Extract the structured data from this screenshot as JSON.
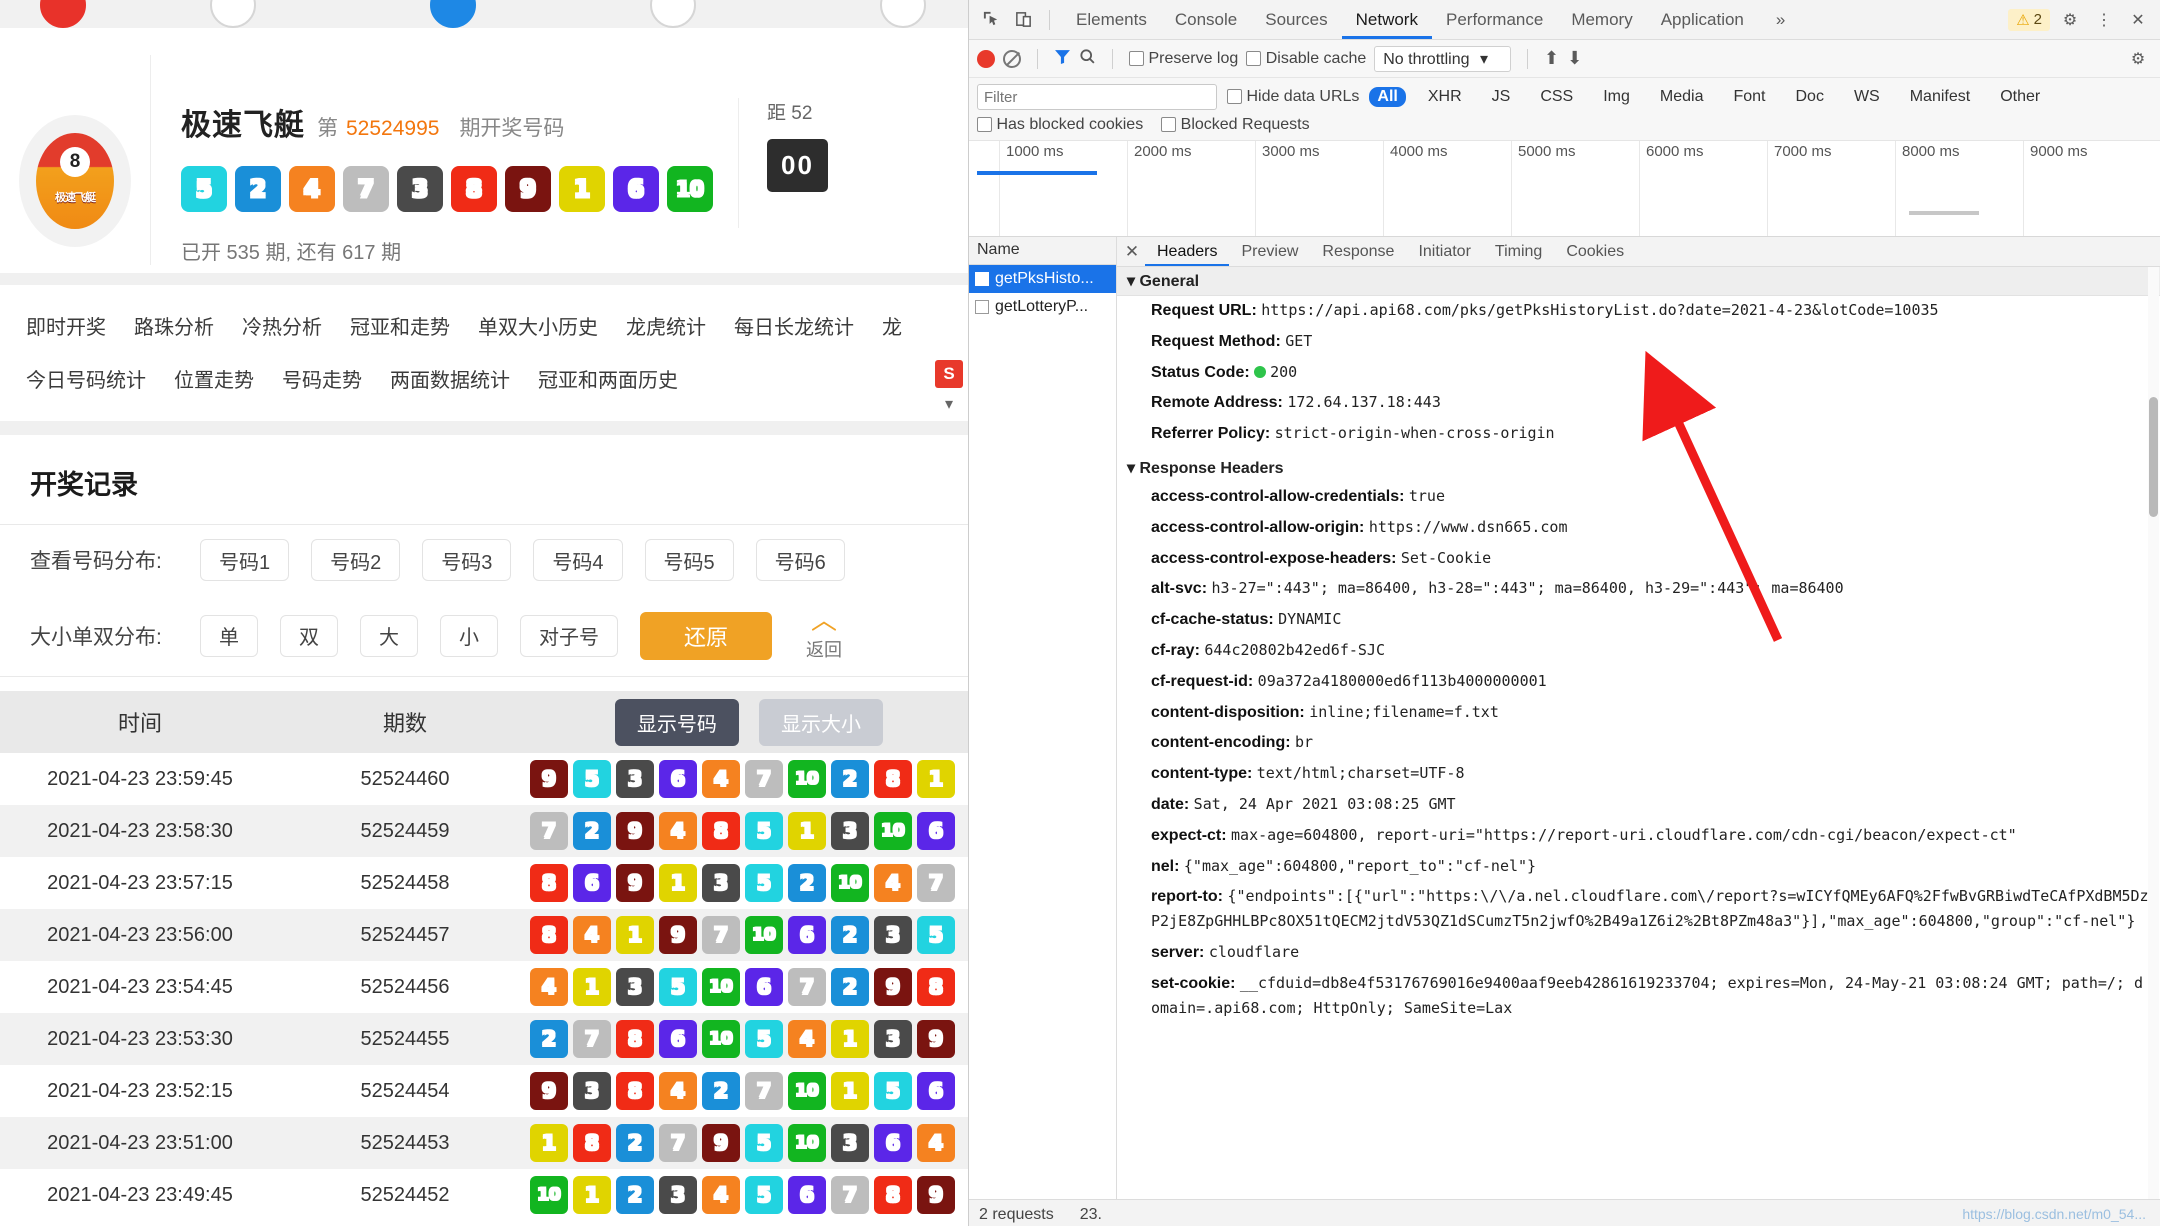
{
  "webpage": {
    "lottery": {
      "name": "极速飞艇",
      "issue_prefix": "第",
      "issue_number": "52524995",
      "issue_suffix": "期开奖号码",
      "logo_badge": "8",
      "logo_text": "极速飞艇",
      "balls": [
        {
          "n": "5",
          "color": "#22d3e0"
        },
        {
          "n": "2",
          "color": "#1a8fd8"
        },
        {
          "n": "4",
          "color": "#f58220"
        },
        {
          "n": "7",
          "color": "#bdbdbd"
        },
        {
          "n": "3",
          "color": "#4a4a4a"
        },
        {
          "n": "8",
          "color": "#f02b16"
        },
        {
          "n": "9",
          "color": "#7a1410"
        },
        {
          "n": "1",
          "color": "#e0d400"
        },
        {
          "n": "6",
          "color": "#5b26e8"
        },
        {
          "n": "10",
          "color": "#12b520"
        }
      ],
      "meta": "已开 535 期, 还有 617 期",
      "countdown_label": "距 52",
      "countdown_value": "00"
    },
    "nav_row1": [
      "即时开奖",
      "路珠分析",
      "冷热分析",
      "冠亚和走势",
      "单双大小历史",
      "龙虎统计",
      "每日长龙统计",
      "龙"
    ],
    "nav_row2": [
      "今日号码统计",
      "位置走势",
      "号码走势",
      "两面数据统计",
      "冠亚和两面历史"
    ],
    "record": {
      "title": "开奖记录",
      "filter1_label": "查看号码分布:",
      "filter1_buttons": [
        "号码1",
        "号码2",
        "号码3",
        "号码4",
        "号码5",
        "号码6"
      ],
      "filter2_label": "大小单双分布:",
      "filter2_buttons": [
        "单",
        "双",
        "大",
        "小",
        "对子号"
      ],
      "restore_label": "还原",
      "back_arrow": "︿",
      "back_label": "返回",
      "table_headers": [
        "时间",
        "期数"
      ],
      "toggle_numbers": "显示号码",
      "toggle_size": "显示大小",
      "rows": [
        {
          "time": "2021-04-23 23:59:45",
          "issue": "52524460",
          "balls": [
            "9",
            "5",
            "3",
            "6",
            "4",
            "7",
            "10",
            "2",
            "8",
            "1"
          ]
        },
        {
          "time": "2021-04-23 23:58:30",
          "issue": "52524459",
          "balls": [
            "7",
            "2",
            "9",
            "4",
            "8",
            "5",
            "1",
            "3",
            "10",
            "6"
          ]
        },
        {
          "time": "2021-04-23 23:57:15",
          "issue": "52524458",
          "balls": [
            "8",
            "6",
            "9",
            "1",
            "3",
            "5",
            "2",
            "10",
            "4",
            "7"
          ]
        },
        {
          "time": "2021-04-23 23:56:00",
          "issue": "52524457",
          "balls": [
            "8",
            "4",
            "1",
            "9",
            "7",
            "10",
            "6",
            "2",
            "3",
            "5"
          ]
        },
        {
          "time": "2021-04-23 23:54:45",
          "issue": "52524456",
          "balls": [
            "4",
            "1",
            "3",
            "5",
            "10",
            "6",
            "7",
            "2",
            "9",
            "8"
          ]
        },
        {
          "time": "2021-04-23 23:53:30",
          "issue": "52524455",
          "balls": [
            "2",
            "7",
            "8",
            "6",
            "10",
            "5",
            "4",
            "1",
            "3",
            "9"
          ]
        },
        {
          "time": "2021-04-23 23:52:15",
          "issue": "52524454",
          "balls": [
            "9",
            "3",
            "8",
            "4",
            "2",
            "7",
            "10",
            "1",
            "5",
            "6"
          ]
        },
        {
          "time": "2021-04-23 23:51:00",
          "issue": "52524453",
          "balls": [
            "1",
            "8",
            "2",
            "7",
            "9",
            "5",
            "10",
            "3",
            "6",
            "4"
          ]
        },
        {
          "time": "2021-04-23 23:49:45",
          "issue": "52524452",
          "balls": [
            "10",
            "1",
            "2",
            "3",
            "4",
            "5",
            "6",
            "7",
            "8",
            "9"
          ]
        }
      ]
    },
    "ball_colors": {
      "1": "#e0d400",
      "2": "#1a8fd8",
      "3": "#4a4a4a",
      "4": "#f58220",
      "5": "#22d3e0",
      "6": "#5b26e8",
      "7": "#bdbdbd",
      "8": "#f02b16",
      "9": "#7a1410",
      "10": "#12b520"
    }
  },
  "devtools": {
    "tabs": [
      "Elements",
      "Console",
      "Sources",
      "Network",
      "Performance",
      "Memory",
      "Application"
    ],
    "active_tab": "Network",
    "more_tabs": "»",
    "warning_count": "2",
    "netbar": {
      "preserve_log": "Preserve log",
      "disable_cache": "Disable cache",
      "throttling": "No throttling"
    },
    "filterbar": {
      "filter_placeholder": "Filter",
      "hide_data_urls": "Hide data URLs",
      "types": [
        "All",
        "XHR",
        "JS",
        "CSS",
        "Img",
        "Media",
        "Font",
        "Doc",
        "WS",
        "Manifest",
        "Other"
      ],
      "active_type": "All",
      "has_blocked_cookies": "Has blocked cookies",
      "blocked_requests": "Blocked Requests"
    },
    "timeline_ticks": [
      "1000 ms",
      "2000 ms",
      "3000 ms",
      "4000 ms",
      "5000 ms",
      "6000 ms",
      "7000 ms",
      "8000 ms",
      "9000 ms"
    ],
    "requests_header": "Name",
    "requests": [
      "getPksHisto...",
      "getLotteryP..."
    ],
    "selected_request": "getPksHisto...",
    "detail_tabs": [
      "Headers",
      "Preview",
      "Response",
      "Initiator",
      "Timing",
      "Cookies"
    ],
    "active_detail_tab": "Headers",
    "general_section": "General",
    "general": [
      {
        "k": "Request URL:",
        "v": "https://api.api68.com/pks/getPksHistoryList.do?date=2021-4-23&lotCode=10035"
      },
      {
        "k": "Request Method:",
        "v": "GET"
      },
      {
        "k": "Status Code:",
        "v": "200",
        "dot": true
      },
      {
        "k": "Remote Address:",
        "v": "172.64.137.18:443"
      },
      {
        "k": "Referrer Policy:",
        "v": "strict-origin-when-cross-origin"
      }
    ],
    "response_section": "Response Headers",
    "response_headers": [
      {
        "k": "access-control-allow-credentials:",
        "v": "true"
      },
      {
        "k": "access-control-allow-origin:",
        "v": "https://www.dsn665.com"
      },
      {
        "k": "access-control-expose-headers:",
        "v": "Set-Cookie"
      },
      {
        "k": "alt-svc:",
        "v": "h3-27=\":443\"; ma=86400, h3-28=\":443\"; ma=86400, h3-29=\":443\"; ma=86400"
      },
      {
        "k": "cf-cache-status:",
        "v": "DYNAMIC"
      },
      {
        "k": "cf-ray:",
        "v": "644c20802b42ed6f-SJC"
      },
      {
        "k": "cf-request-id:",
        "v": "09a372a4180000ed6f113b4000000001"
      },
      {
        "k": "content-disposition:",
        "v": "inline;filename=f.txt"
      },
      {
        "k": "content-encoding:",
        "v": "br"
      },
      {
        "k": "content-type:",
        "v": "text/html;charset=UTF-8"
      },
      {
        "k": "date:",
        "v": "Sat, 24 Apr 2021 03:08:25 GMT"
      },
      {
        "k": "expect-ct:",
        "v": "max-age=604800, report-uri=\"https://report-uri.cloudflare.com/cdn-cgi/beacon/expect-ct\""
      },
      {
        "k": "nel:",
        "v": "{\"max_age\":604800,\"report_to\":\"cf-nel\"}"
      },
      {
        "k": "report-to:",
        "v": "{\"endpoints\":[{\"url\":\"https:\\/\\/a.nel.cloudflare.com\\/report?s=wICYfQMEy6AFQ%2FfwBvGRBiwdTeCAfPXdBM5DzP2jE8ZpGHHLBPc8OX51tQECM2jtdV53QZ1dSCumzT5n2jwfO%2B49a1Z6i2%2Bt8PZm48a3\"}],\"max_age\":604800,\"group\":\"cf-nel\"}"
      },
      {
        "k": "server:",
        "v": "cloudflare"
      },
      {
        "k": "set-cookie:",
        "v": "__cfduid=db8e4f53176769016e9400aaf9eeb42861619233704; expires=Mon, 24-May-21 03:08:24 GMT; path=/; domain=.api68.com; HttpOnly; SameSite=Lax"
      }
    ],
    "status": {
      "requests": "2 requests",
      "transferred": "23."
    },
    "watermark": "https://blog.csdn.net/m0_54..."
  }
}
